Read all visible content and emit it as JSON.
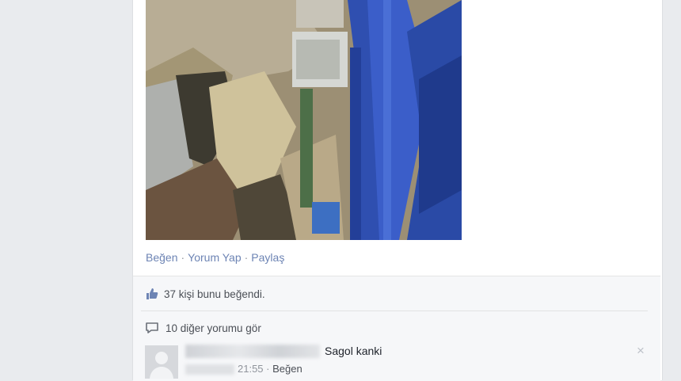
{
  "post": {
    "actions": {
      "like": "Beğen",
      "comment": "Yorum Yap",
      "share": "Paylaş",
      "separator": "·"
    }
  },
  "ufi": {
    "likes_text": "37 kişi bunu beğendi.",
    "more_comments": "10 diğer yorumu gör"
  },
  "comment": {
    "text": "Sagol kanki",
    "time": "21:55",
    "separator": "·",
    "like": "Beğen",
    "close": "×"
  },
  "colors": {
    "link": "#6d84b4",
    "text": "#4b4f56",
    "meta": "#90949c",
    "crane_blue": "#2f4fb0"
  },
  "icons": {
    "likes": "thumbs-up-icon",
    "comments": "speech-bubble-icon",
    "close": "close-icon"
  }
}
